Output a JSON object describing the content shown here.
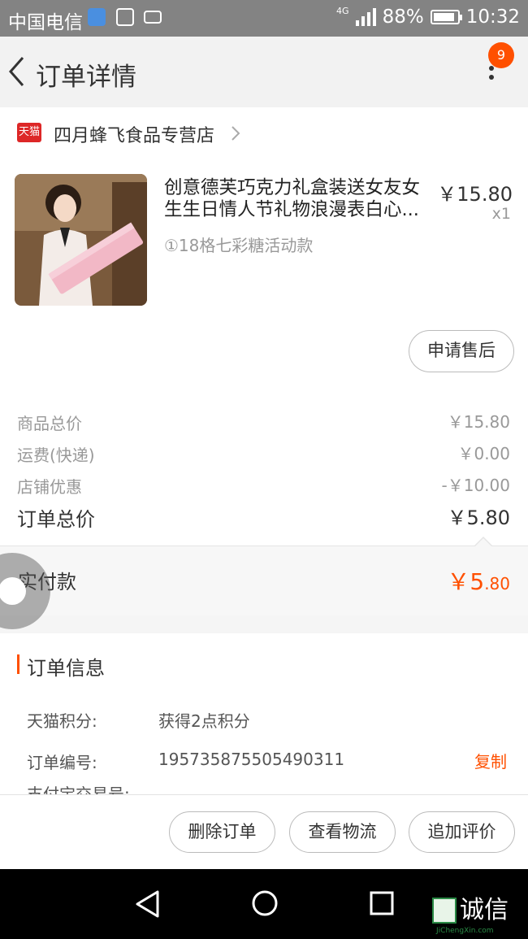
{
  "status_bar": {
    "carrier": "中国电信",
    "network": "4G",
    "battery": "88%",
    "time": "10:32"
  },
  "header": {
    "title": "订单详情",
    "badge": "9"
  },
  "shop": {
    "name": "四月蜂飞食品专营店",
    "logo_text": "天猫"
  },
  "product": {
    "title_line1": "创意德芙巧克力礼盒装送女友女",
    "title_line2": "生生日情人节礼物浪漫表白心...",
    "sku": "①18格七彩糖活动款",
    "price": "￥15.80",
    "qty": "x1",
    "aftersale_label": "申请售后"
  },
  "summary": {
    "rows": [
      {
        "label": "商品总价",
        "value": "￥15.80"
      },
      {
        "label": "运费(快递)",
        "value": "￥0.00"
      },
      {
        "label": "店铺优惠",
        "value": "-￥10.00"
      }
    ],
    "total_label": "订单总价",
    "total_value": "￥5.80"
  },
  "paid": {
    "label": "实付款",
    "currency": "￥",
    "int": "5",
    "dec": ".80"
  },
  "order_info": {
    "title": "订单信息",
    "rows": [
      {
        "label": "天猫积分:",
        "value": "获得2点积分"
      },
      {
        "label": "订单编号:",
        "value": "1957358755054903​11"
      }
    ],
    "copy_label": "复制",
    "cut_row_label": "支付宝交易号:"
  },
  "actions": {
    "delete": "删除订单",
    "track": "查看物流",
    "review": "追加评价"
  },
  "watermark": {
    "text": "诚信",
    "sub": "JiChengXin.com"
  },
  "colors": {
    "accent": "#ff5000",
    "tmall_red": "#dd2727",
    "status_bar": "#838383"
  },
  "icons": [
    "back-chevron-icon",
    "more-vert-icon",
    "tmall-logo-icon",
    "chevron-right-icon",
    "sim-icon",
    "image-icon",
    "keyboard-icon",
    "signal-icon",
    "battery-icon",
    "nav-back-icon",
    "nav-home-icon",
    "nav-recents-icon"
  ]
}
